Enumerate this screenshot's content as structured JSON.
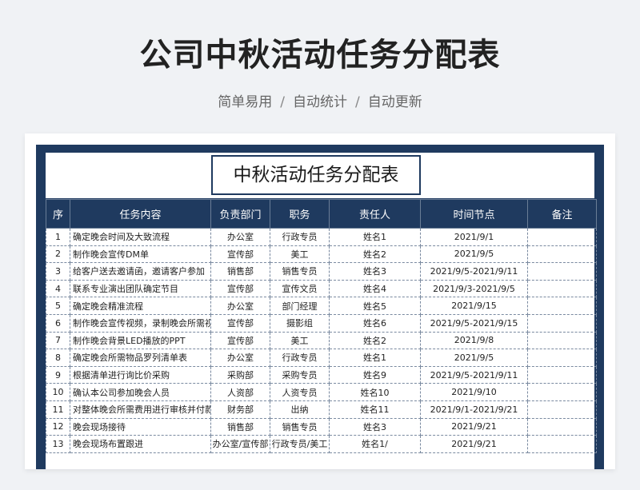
{
  "header": {
    "title": "公司中秋活动任务分配表",
    "tags": [
      "简单易用",
      "自动统计",
      "自动更新"
    ],
    "separator": "/"
  },
  "sheet": {
    "title": "中秋活动任务分配表",
    "columns": [
      "序",
      "任务内容",
      "负责部门",
      "职务",
      "责任人",
      "时间节点",
      "备注"
    ],
    "rows": [
      [
        "1",
        "确定晚会时间及大致流程",
        "办公室",
        "行政专员",
        "姓名1",
        "2021/9/1",
        ""
      ],
      [
        "2",
        "制作晚会宣传DM单",
        "宣传部",
        "美工",
        "姓名2",
        "2021/9/5",
        ""
      ],
      [
        "3",
        "给客户送去邀请函，邀请客户参加",
        "销售部",
        "销售专员",
        "姓名3",
        "2021/9/5-2021/9/11",
        ""
      ],
      [
        "4",
        "联系专业演出团队确定节目",
        "宣传部",
        "宣传文员",
        "姓名4",
        "2021/9/3-2021/9/5",
        ""
      ],
      [
        "5",
        "确定晚会精准流程",
        "办公室",
        "部门经理",
        "姓名5",
        "2021/9/15",
        ""
      ],
      [
        "6",
        "制作晚会宣传视频，录制晚会所需视频",
        "宣传部",
        "摄影组",
        "姓名6",
        "2021/9/5-2021/9/15",
        ""
      ],
      [
        "7",
        "制作晚会背景LED播放的PPT",
        "宣传部",
        "美工",
        "姓名2",
        "2021/9/8",
        ""
      ],
      [
        "8",
        "确定晚会所需物品罗列清单表",
        "办公室",
        "行政专员",
        "姓名1",
        "2021/9/5",
        ""
      ],
      [
        "9",
        "根据清单进行询比价采购",
        "采购部",
        "采购专员",
        "姓名9",
        "2021/9/5-2021/9/11",
        ""
      ],
      [
        "10",
        "确认本公司参加晚会人员",
        "人资部",
        "人资专员",
        "姓名10",
        "2021/9/10",
        ""
      ],
      [
        "11",
        "对整体晚会所需费用进行审核并付款",
        "财务部",
        "出纳",
        "姓名11",
        "2021/9/1-2021/9/21",
        ""
      ],
      [
        "12",
        "晚会现场接待",
        "销售部",
        "销售专员",
        "姓名3",
        "2021/9/21",
        ""
      ],
      [
        "13",
        "晚会现场布置跟进",
        "办公室/宣传部",
        "行政专员/美工",
        "姓名1/",
        "2021/9/21",
        ""
      ]
    ]
  }
}
